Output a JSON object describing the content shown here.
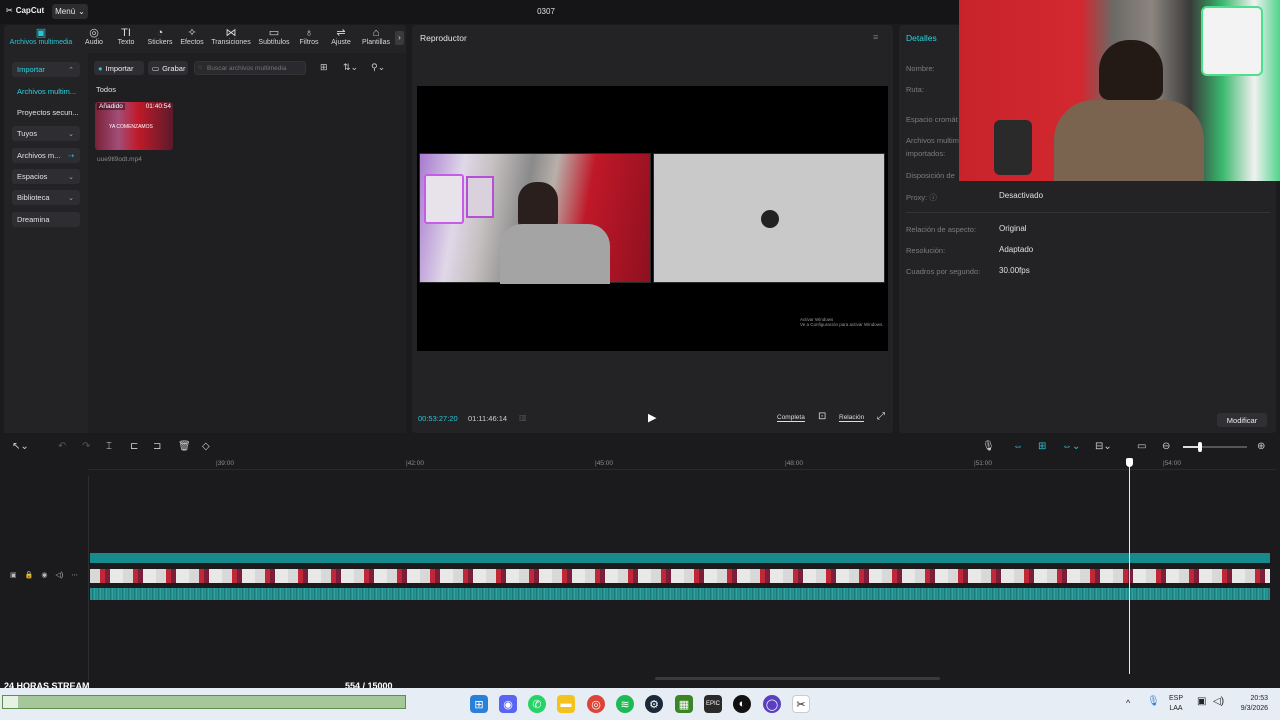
{
  "app": {
    "logo_text": "CapCut",
    "menu_label": "Menú",
    "title": "0307"
  },
  "toolbar": {
    "tools": [
      {
        "label": "Archivos multimedia",
        "icon": "media-icon"
      },
      {
        "label": "Audio",
        "icon": "audio-icon"
      },
      {
        "label": "Texto",
        "icon": "text-icon"
      },
      {
        "label": "Stickers",
        "icon": "sticker-icon"
      },
      {
        "label": "Efectos",
        "icon": "effects-icon"
      },
      {
        "label": "Transiciones",
        "icon": "transitions-icon"
      },
      {
        "label": "Subtítulos",
        "icon": "subtitles-icon"
      },
      {
        "label": "Filtros",
        "icon": "filters-icon"
      },
      {
        "label": "Ajuste",
        "icon": "adjust-icon"
      },
      {
        "label": "Plantillas",
        "icon": "templates-icon"
      }
    ]
  },
  "sidebar": {
    "items": [
      {
        "label": "Importar"
      },
      {
        "label": "Archivos multim..."
      },
      {
        "label": "Proyectos secun..."
      },
      {
        "label": "Tuyos"
      },
      {
        "label": "Archivos m..."
      },
      {
        "label": "Espacios"
      },
      {
        "label": "Biblioteca"
      },
      {
        "label": "Dreamina"
      }
    ]
  },
  "media": {
    "import_label": "Importar",
    "record_label": "Grabar",
    "search_placeholder": "Buscar archivos multimedia",
    "filter_all": "Todos",
    "clip": {
      "badge": "Añadido",
      "duration": "01:40:54",
      "overlay_text": "YA COMENZAMOS",
      "filename": "uue9tl9odt.mp4"
    }
  },
  "player": {
    "title": "Reproductor",
    "current_time": "00:53:27:20",
    "total_time": "01:11:46:14",
    "full_label": "Completa",
    "ratio_label": "Relación",
    "watermark_line1": "Activar Windows",
    "watermark_line2": "Ve a Configuración para activar Windows."
  },
  "details": {
    "title": "Detalles",
    "labels": [
      "Nombre:",
      "Ruta:",
      "Espacio cromát",
      "Archivos multim",
      "importados:",
      "Disposición de",
      "Proxy:",
      "Relación de aspecto:",
      "Resolución:",
      "Cuadros por segundo:"
    ],
    "proxy_value": "Desactivado",
    "aspect_value": "Original",
    "resolution_value": "Adaptado",
    "fps_value": "30.00fps",
    "modify_label": "Modificar"
  },
  "timeline": {
    "ruler": [
      "|39:00",
      "|42:00",
      "|45:00",
      "|48:00",
      "|51:00",
      "|54:00"
    ]
  },
  "stream": {
    "title": "24 HORAS STREAM",
    "count": "554 / 15000",
    "progress": 0.037
  },
  "tray": {
    "lang1": "ESP",
    "lang2": "LAA",
    "time": "20:53",
    "date": "9/3/2026"
  }
}
